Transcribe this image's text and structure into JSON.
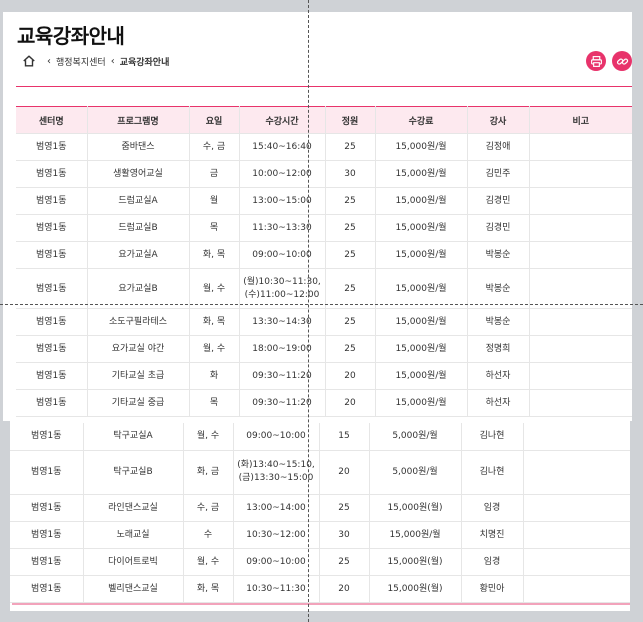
{
  "page": {
    "title": "교육강좌안내"
  },
  "breadcrumb": {
    "home_icon": "home-icon",
    "items": [
      "행정복지센터",
      "교육강좌안내"
    ]
  },
  "tools": {
    "print_icon": "print-icon",
    "link_icon": "link-icon",
    "accent": "#e8336b"
  },
  "table": {
    "headers": [
      "센터명",
      "프로그램명",
      "요일",
      "수강시간",
      "정원",
      "수강료",
      "강사",
      "비고"
    ],
    "rows_top": [
      [
        "범영1동",
        "줌바댄스",
        "수, 금",
        "15:40~16:40",
        "25",
        "15,000원/월",
        "김정애",
        ""
      ],
      [
        "범영1동",
        "생활영어교실",
        "금",
        "10:00~12:00",
        "30",
        "15,000원/월",
        "김민주",
        ""
      ],
      [
        "범영1동",
        "드럼교실A",
        "월",
        "13:00~15:00",
        "25",
        "15,000원/월",
        "김경민",
        ""
      ],
      [
        "범영1동",
        "드럼교실B",
        "목",
        "11:30~13:30",
        "25",
        "15,000원/월",
        "김경민",
        ""
      ],
      [
        "범영1동",
        "요가교실A",
        "화, 목",
        "09:00~10:00",
        "25",
        "15,000원/월",
        "박봉순",
        ""
      ],
      [
        "범영1동",
        "요가교실B",
        "월, 수",
        "(월)10:30~11:30,\n(수)11:00~12:00",
        "25",
        "15,000원/월",
        "박봉순",
        ""
      ],
      [
        "범영1동",
        "소도구필라테스",
        "화, 목",
        "13:30~14:30",
        "25",
        "15,000원/월",
        "박봉순",
        ""
      ],
      [
        "범영1동",
        "요가교실 야간",
        "월, 수",
        "18:00~19:00",
        "25",
        "15,000원/월",
        "정명희",
        ""
      ],
      [
        "범영1동",
        "기타교실 초급",
        "화",
        "09:30~11:20",
        "20",
        "15,000원/월",
        "하선자",
        ""
      ],
      [
        "범영1동",
        "기타교실 중급",
        "목",
        "09:30~11:20",
        "20",
        "15,000원/월",
        "하선자",
        ""
      ]
    ],
    "rows_bottom": [
      [
        "범영1동",
        "탁구교실A",
        "월, 수",
        "09:00~10:00",
        "15",
        "5,000원/월",
        "김나현",
        ""
      ],
      [
        "범영1동",
        "탁구교실B",
        "화, 금",
        "(화)13:40~15:10,\n(금)13:30~15:00",
        "20",
        "5,000원/월",
        "김나현",
        ""
      ],
      [
        "범영1동",
        "라인댄스교실",
        "수, 금",
        "13:00~14:00",
        "25",
        "15,000원(월)",
        "임경",
        ""
      ],
      [
        "범영1동",
        "노래교실",
        "수",
        "10:30~12:00",
        "30",
        "15,000원/월",
        "치명진",
        ""
      ],
      [
        "범영1동",
        "다이어트로빅",
        "월, 수",
        "09:00~10:00",
        "25",
        "15,000원(월)",
        "임경",
        ""
      ],
      [
        "범영1동",
        "벨리댄스교실",
        "화, 목",
        "10:30~11:30",
        "20",
        "15,000원(월)",
        "황민아",
        ""
      ]
    ]
  }
}
